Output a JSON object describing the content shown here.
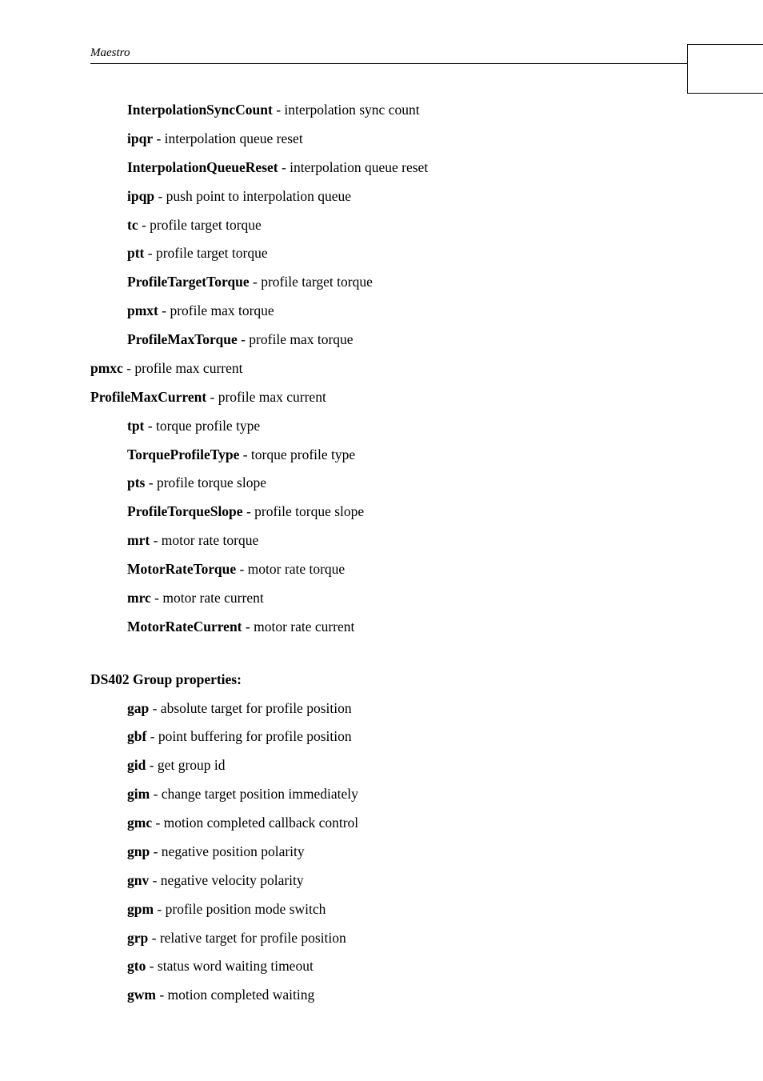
{
  "header": {
    "title": "Maestro"
  },
  "axis_props": [
    {
      "term": "InterpolationSyncCount",
      "desc": " - interpolation sync count",
      "indent": true
    },
    {
      "term": "ipqr",
      "desc": " - interpolation queue reset",
      "indent": true
    },
    {
      "term": "InterpolationQueueReset",
      "desc": " - interpolation queue reset",
      "indent": true
    },
    {
      "term": "ipqp",
      "desc": " - push point to interpolation queue",
      "indent": true
    },
    {
      "term": "tc",
      "desc": " - profile target torque",
      "indent": true
    },
    {
      "term": "ptt",
      "desc": " - profile target torque",
      "indent": true
    },
    {
      "term": "ProfileTargetTorque",
      "desc": " - profile target torque",
      "indent": true
    },
    {
      "term": "pmxt",
      "desc": " - profile max torque",
      "indent": true
    },
    {
      "term": "ProfileMaxTorque",
      "desc": " - profile max torque",
      "indent": true
    },
    {
      "term": "pmxc",
      "desc": " - profile max current",
      "indent": false
    },
    {
      "term": "ProfileMaxCurrent",
      "desc": " - profile max current",
      "indent": false
    },
    {
      "term": "tpt",
      "desc": " - torque profile type",
      "indent": true
    },
    {
      "term": "TorqueProfileType",
      "desc": " - torque profile type",
      "indent": true
    },
    {
      "term": "pts",
      "desc": " - profile torque slope",
      "indent": true
    },
    {
      "term": "ProfileTorqueSlope",
      "desc": " - profile torque slope",
      "indent": true
    },
    {
      "term": "mrt",
      "desc": " - motor rate torque",
      "indent": true
    },
    {
      "term": "MotorRateTorque",
      "desc": " - motor rate torque",
      "indent": true
    },
    {
      "term": "mrc",
      "desc": " - motor rate current",
      "indent": true
    },
    {
      "term": "MotorRateCurrent",
      "desc": " - motor rate current",
      "indent": true
    }
  ],
  "group_section": {
    "heading": "DS402 Group properties:"
  },
  "group_props": [
    {
      "term": "gap",
      "desc": " - absolute target for profile position"
    },
    {
      "term": "gbf",
      "desc": " - point buffering for profile position"
    },
    {
      "term": "gid",
      "desc": " - get group id"
    },
    {
      "term": "gim",
      "desc": " - change target position immediately"
    },
    {
      "term": "gmc",
      "desc": " - motion completed callback control"
    },
    {
      "term": "gnp",
      "desc": " - negative position polarity"
    },
    {
      "term": "gnv",
      "desc": " - negative velocity polarity"
    },
    {
      "term": "gpm",
      "desc": " - profile position mode switch"
    },
    {
      "term": "grp",
      "desc": " - relative target for profile position"
    },
    {
      "term": "gto",
      "desc": " - status word waiting timeout"
    },
    {
      "term": "gwm",
      "desc": " - motion completed waiting"
    }
  ]
}
